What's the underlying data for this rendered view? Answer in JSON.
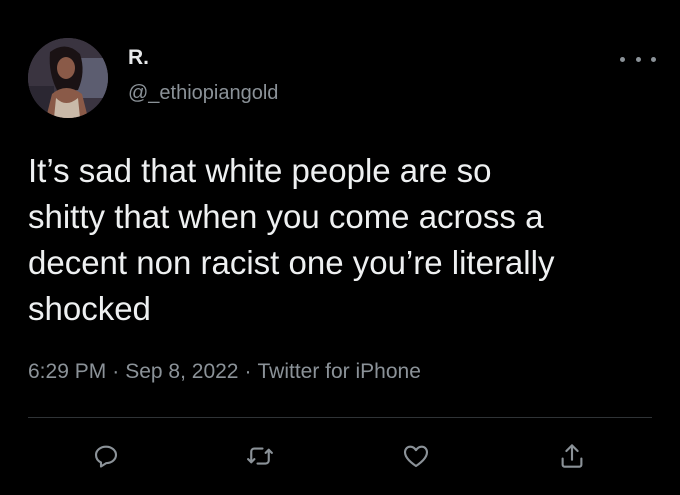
{
  "author": {
    "display_name": "R.",
    "handle": "@_ethiopiangold",
    "avatar_icon": "profile-photo"
  },
  "tweet": {
    "text_lines": [
      "It’s sad that white people are so",
      "shitty that when you come across a",
      "decent non racist one you’re literally",
      "shocked"
    ],
    "time": "6:29 PM",
    "separator": "·",
    "date": "Sep 8, 2022",
    "source": "Twitter for iPhone"
  },
  "actions": {
    "reply_icon": "reply-icon",
    "retweet_icon": "retweet-icon",
    "like_icon": "like-icon",
    "share_icon": "share-icon",
    "more_icon": "more-icon"
  },
  "colors": {
    "background": "#000000",
    "primary_text": "#e7e9ea",
    "secondary_text": "#8b9298",
    "divider": "#2f3336"
  }
}
